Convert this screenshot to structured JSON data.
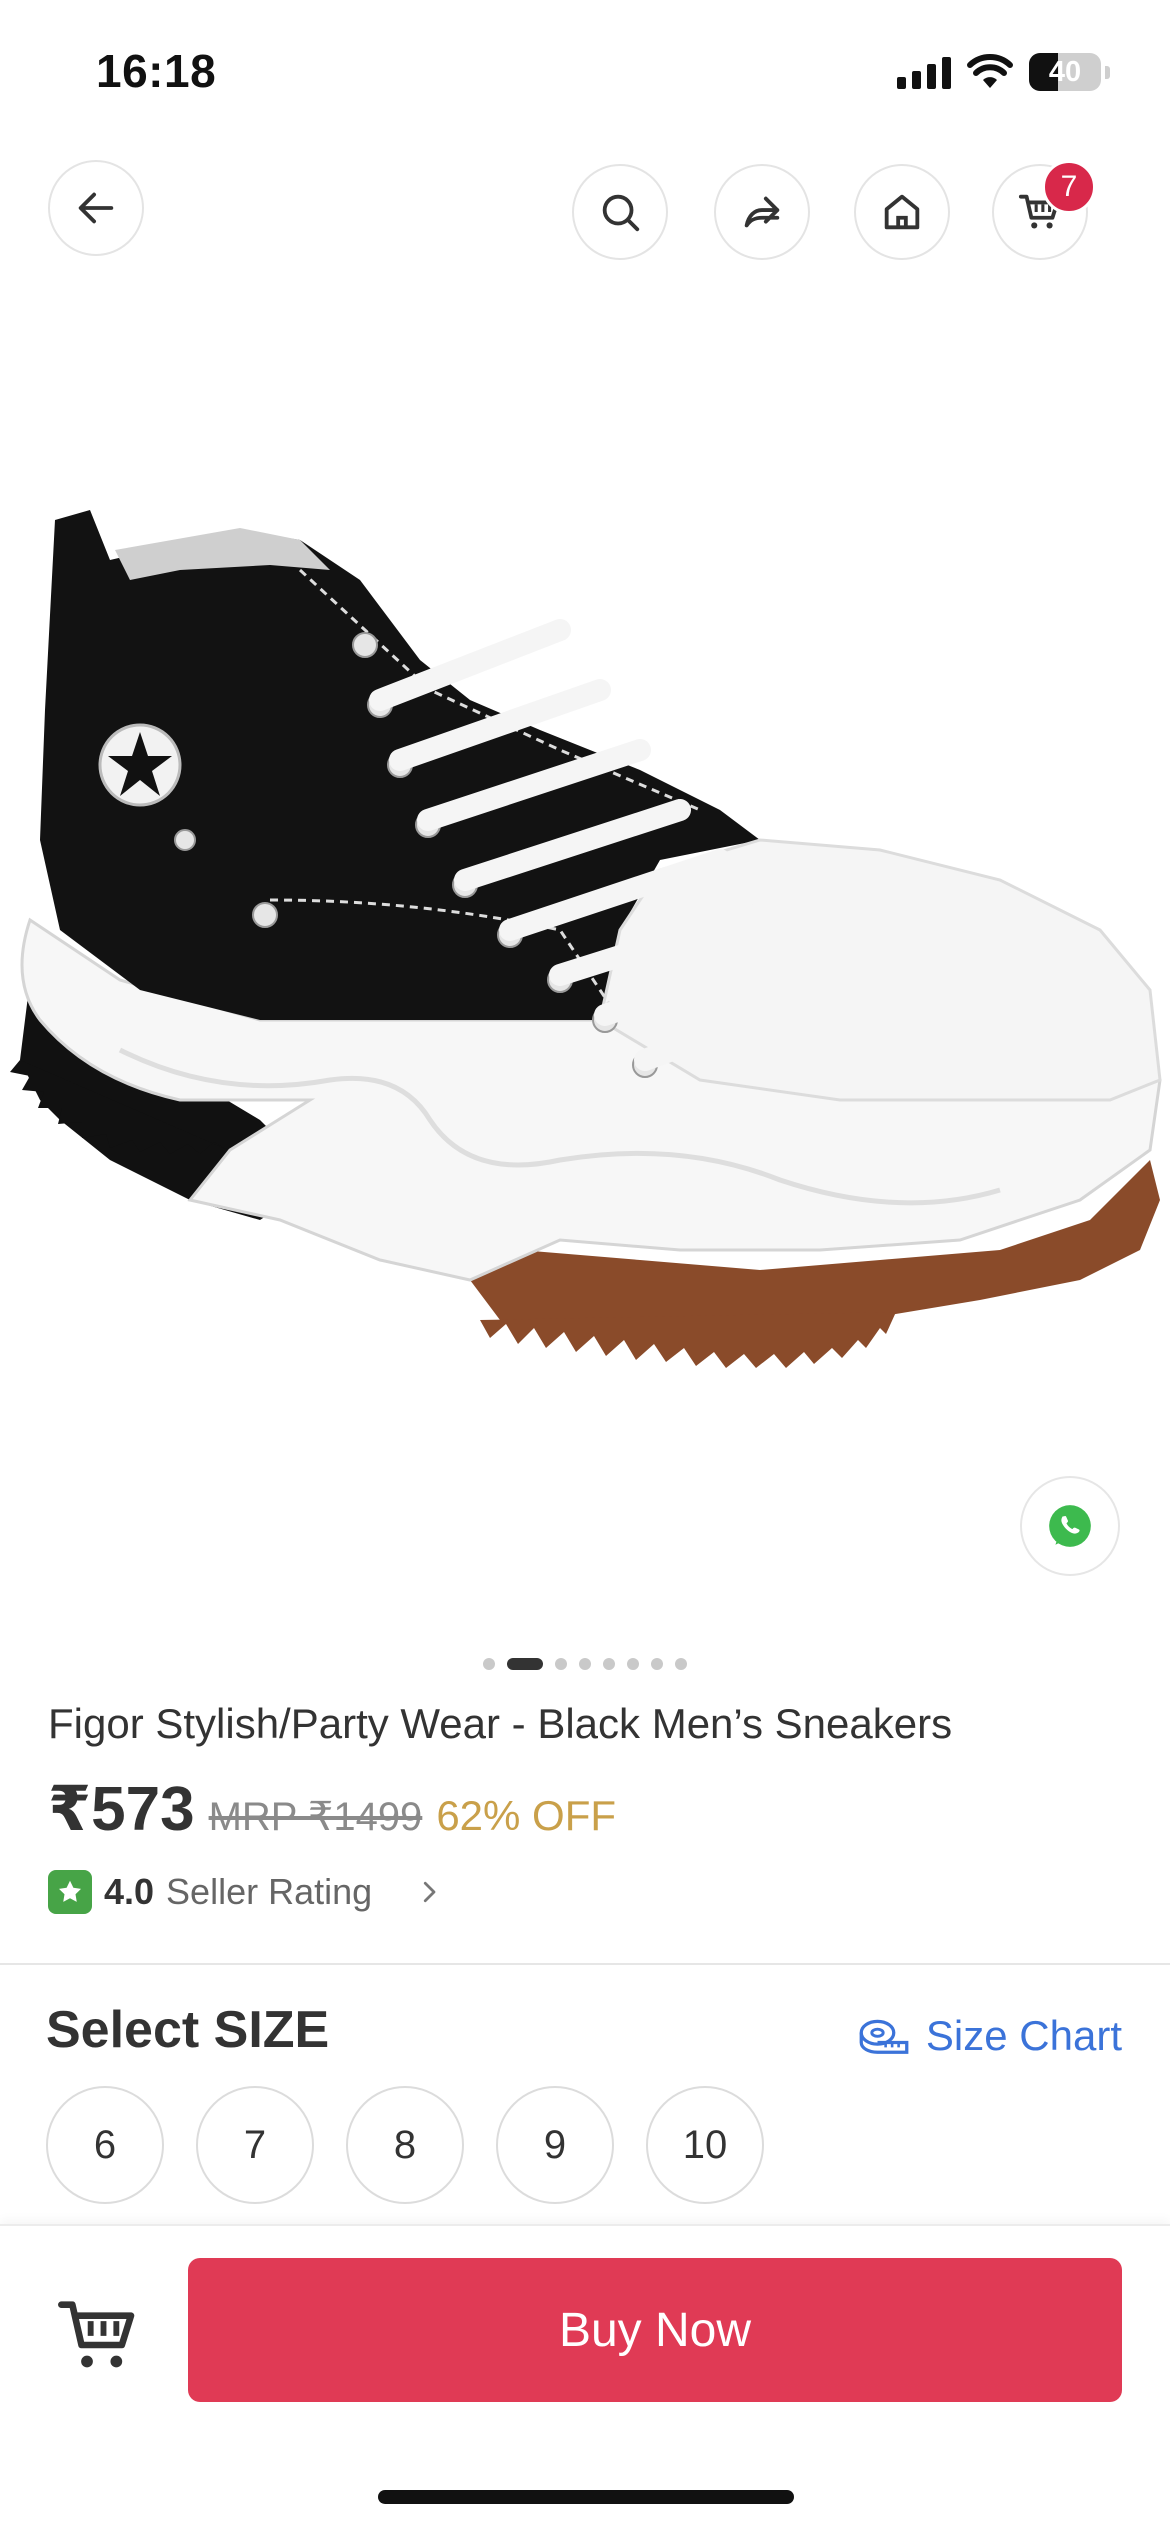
{
  "status_bar": {
    "time": "16:18",
    "battery_level": "40",
    "icons": [
      "signal-icon",
      "wifi-icon",
      "battery-icon"
    ]
  },
  "nav": {
    "back_icon": "arrow-left-icon",
    "actions": [
      "search-icon",
      "share-icon",
      "home-icon",
      "cart-icon"
    ],
    "cart_count": "7"
  },
  "product": {
    "image": "black-high-top-sneaker",
    "gallery": {
      "total_images": 8,
      "active_index": 1
    },
    "title": "Figor Stylish/Party Wear - Black Men’s Sneakers",
    "price": "₹573",
    "mrp": "MRP ₹1499",
    "discount": "62% OFF",
    "rating": "4.0",
    "rating_label": "Seller Rating"
  },
  "size_section": {
    "heading": "Select SIZE",
    "size_chart_label": "Size Chart",
    "sizes": [
      "6",
      "7",
      "8",
      "9",
      "10"
    ]
  },
  "bottom_bar": {
    "buy_now_label": "Buy Now",
    "cart_icon": "cart-icon"
  },
  "colors": {
    "primary": "#e03a55",
    "badge": "#d8284a",
    "discount": "#c9a04a",
    "link": "#3b73d9",
    "rating": "#47a447"
  }
}
